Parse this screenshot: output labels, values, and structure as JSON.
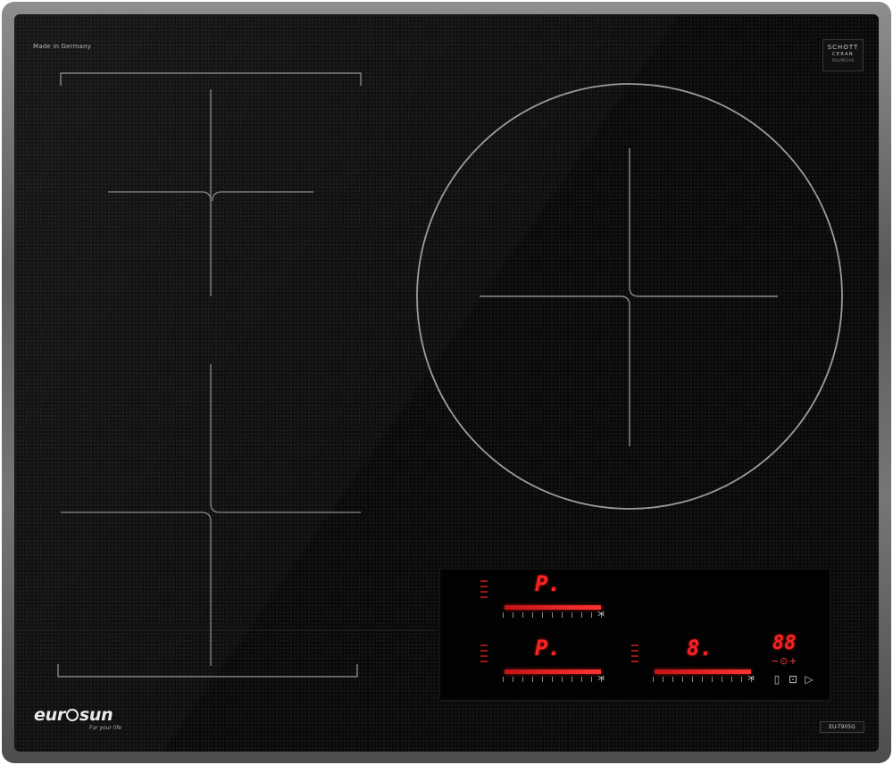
{
  "made_in": "Made in Germany",
  "glass_brand": {
    "line1": "SCHOTT",
    "line2": "CERAN",
    "line3": "SOLARGLAS"
  },
  "zones": [
    {
      "id": "left-top",
      "shape": "flex"
    },
    {
      "id": "left-bottom",
      "shape": "flex"
    },
    {
      "id": "right",
      "shape": "circle"
    }
  ],
  "control_panel": {
    "zone_displays": [
      {
        "zone": "top-left",
        "value": "P."
      },
      {
        "zone": "bottom-left",
        "value": "P."
      },
      {
        "zone": "bottom-right",
        "value": "8."
      }
    ],
    "slider_levels": [
      {
        "zone": "top-left",
        "level": 1.0
      },
      {
        "zone": "bottom-left",
        "level": 1.0
      },
      {
        "zone": "bottom-right",
        "level": 1.0
      }
    ],
    "timer_display": "88",
    "timer_controls": "−⊙+",
    "bottom_icons": [
      "pause-icon",
      "settings-icon",
      "lock-icon"
    ],
    "accent_color": "#ff2020"
  },
  "brand": {
    "logo_prefix": "eur",
    "logo_suffix": "sun",
    "tagline": "For your life"
  },
  "model": "EU-T905G"
}
